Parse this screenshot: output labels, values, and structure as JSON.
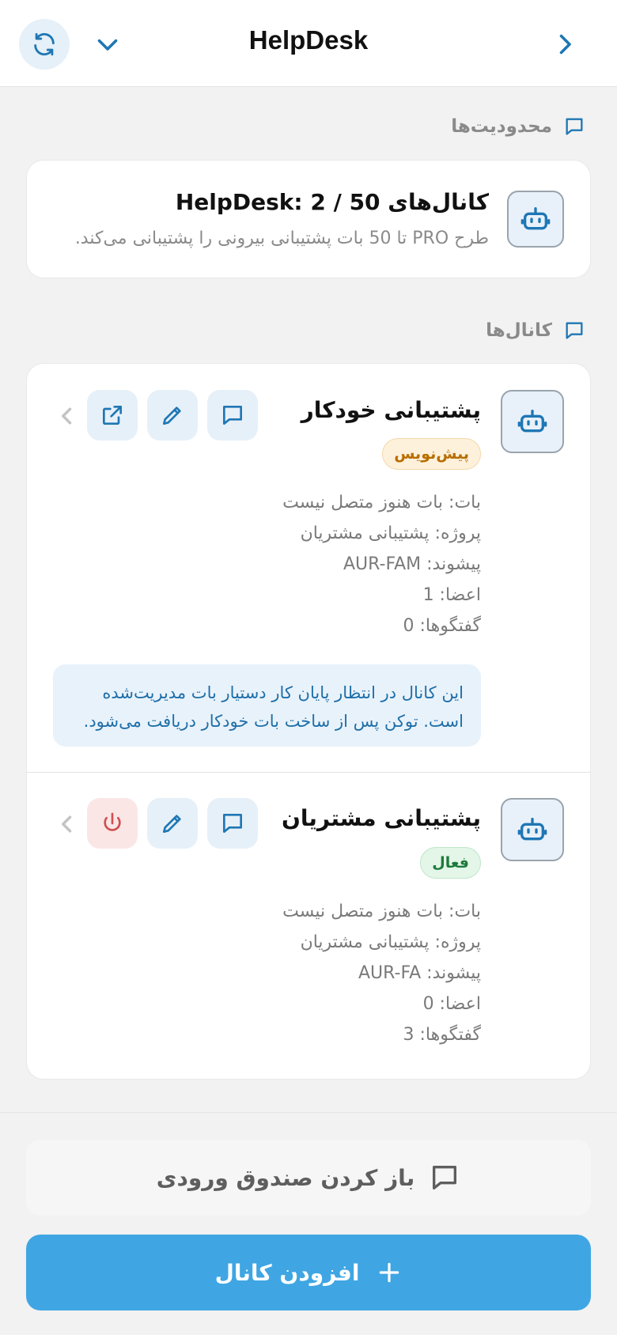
{
  "header": {
    "title": "HelpDesk",
    "icons": {
      "refresh": "refresh-icon",
      "dropdown": "chevron-down-icon",
      "back": "chevron-right-icon"
    }
  },
  "limits_section": {
    "label": "محدودیت‌ها"
  },
  "limits_card": {
    "title": "کانال‌های HelpDesk: 2 / 50",
    "subtitle": "طرح PRO تا 50 بات پشتیبانی بیرونی را پشتیبانی می‌کند."
  },
  "channels_section": {
    "label": "کانال‌ها"
  },
  "channels": [
    {
      "name": "پشتیبانی خودکار",
      "status": "پیش‌نویس",
      "bot": "بات: بات هنوز متصل نیست",
      "project": "پروژه: پشتیبانی مشتریان",
      "prefix": "پیشوند: AUR-FAM",
      "members": "اعضا: 1",
      "conversations": "گفتگوها: 0",
      "note": "این کانال در انتظار پایان کار دستیار بات مدیریت‌شده است. توکن پس از ساخت بات خودکار دریافت می‌شود.",
      "actions": [
        "chat-icon",
        "edit-icon",
        "external-link-icon"
      ]
    },
    {
      "name": "پشتیبانی مشتریان",
      "status": "فعال",
      "bot": "بات: بات هنوز متصل نیست",
      "project": "پروژه: پشتیبانی مشتریان",
      "prefix": "پیشوند: AUR-FA",
      "members": "اعضا: 0",
      "conversations": "گفتگوها: 3",
      "actions": [
        "chat-icon",
        "edit-icon",
        "power-icon"
      ]
    }
  ],
  "footer": {
    "open_inbox": "باز کردن صندوق ورودی",
    "add_channel": "افزودن کانال"
  },
  "colors": {
    "accent": "#3fa6e3",
    "icon_blue": "#1f77b4",
    "draft_text": "#b86e00",
    "active_text": "#1e7a3a",
    "danger": "#d05050"
  }
}
